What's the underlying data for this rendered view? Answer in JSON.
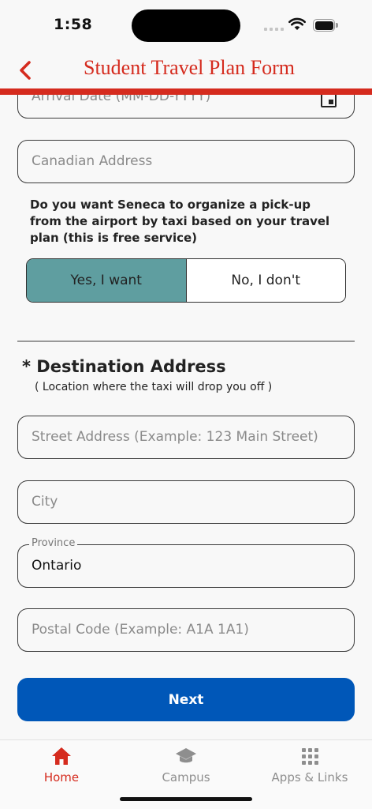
{
  "status_bar": {
    "time": "1:58"
  },
  "header": {
    "title": "Student Travel Plan Form",
    "back_icon": "chevron-left-icon"
  },
  "form": {
    "arrival_date": {
      "placeholder": "Arrival Date (MM-DD-YYYY)"
    },
    "canadian_address": {
      "placeholder": "Canadian Address"
    },
    "pickup_question": "Do you want Seneca to organize a pick-up from the airport by taxi based on your travel plan (this is free service)",
    "pickup_options": [
      {
        "label": "Yes, I want",
        "selected": true
      },
      {
        "label": "No, I don't",
        "selected": false
      }
    ],
    "destination": {
      "title": "* Destination Address",
      "subtitle": "( Location where the taxi will drop you off )",
      "street": {
        "placeholder": "Street Address (Example: 123 Main Street)"
      },
      "city": {
        "placeholder": "City"
      },
      "province": {
        "label": "Province",
        "value": "Ontario"
      },
      "postal_code": {
        "placeholder": "Postal Code (Example: A1A 1A1)"
      }
    },
    "next_label": "Next"
  },
  "tabbar": {
    "items": [
      {
        "label": "Home",
        "icon": "home-icon",
        "active": true
      },
      {
        "label": "Campus",
        "icon": "graduation-cap-icon",
        "active": false
      },
      {
        "label": "Apps & Links",
        "icon": "grid-icon",
        "active": false
      }
    ]
  },
  "colors": {
    "brand_red": "#d52b1e",
    "selected_teal": "#5f9ea0",
    "button_blue": "#0057b8"
  }
}
